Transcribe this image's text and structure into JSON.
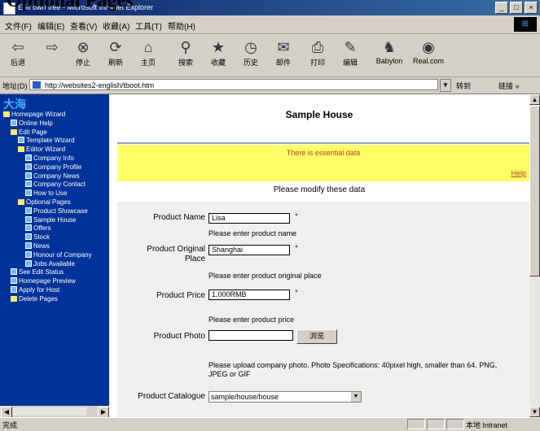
{
  "slide_title": "Optional Pages",
  "window": {
    "title": "Edit own tree - Microsoft Internet Explorer",
    "controls": [
      "_",
      "□",
      "×"
    ]
  },
  "menu": {
    "items": [
      "文件(F)",
      "编辑(E)",
      "查看(V)",
      "收藏(A)",
      "工具(T)",
      "帮助(H)"
    ]
  },
  "toolbar": {
    "buttons": [
      {
        "label": "后退",
        "icon": "back-arrow-icon",
        "glyph": "⇦"
      },
      {
        "label": "",
        "icon": "forward-arrow-icon",
        "glyph": "⇨"
      },
      {
        "label": "停止",
        "icon": "stop-icon",
        "glyph": "⊗"
      },
      {
        "label": "刷新",
        "icon": "refresh-icon",
        "glyph": "⟳"
      },
      {
        "label": "主页",
        "icon": "home-icon",
        "glyph": "⌂"
      },
      {
        "label": "搜索",
        "icon": "search-icon",
        "glyph": "⚲"
      },
      {
        "label": "收藏",
        "icon": "favorites-icon",
        "glyph": "★"
      },
      {
        "label": "历史",
        "icon": "history-icon",
        "glyph": "◷"
      },
      {
        "label": "邮件",
        "icon": "mail-icon",
        "glyph": "✉"
      },
      {
        "label": "打印",
        "icon": "print-icon",
        "glyph": "⎙"
      },
      {
        "label": "编辑",
        "icon": "edit-icon",
        "glyph": "✎"
      },
      {
        "label": "Babylon",
        "icon": "babylon-icon",
        "glyph": "♞"
      },
      {
        "label": "Real.com",
        "icon": "real-icon",
        "glyph": "◉"
      }
    ]
  },
  "address": {
    "label": "地址(D)",
    "url": "http://websites2-english/tboot.htm",
    "go": "转到",
    "links": "链接 »"
  },
  "sidebar": {
    "header": "大海",
    "tree": [
      {
        "label": "Homepage Wizard",
        "icon": "book",
        "indent": 0
      },
      {
        "label": "Online Help",
        "icon": "page",
        "indent": 1
      },
      {
        "label": "Edit Page",
        "icon": "book",
        "indent": 1
      },
      {
        "label": "Template Wizard",
        "icon": "page",
        "indent": 2
      },
      {
        "label": "Editor Wizard",
        "icon": "book",
        "indent": 2
      },
      {
        "label": "Company Info",
        "icon": "page",
        "indent": 3
      },
      {
        "label": "Company Profile",
        "icon": "page",
        "indent": 3
      },
      {
        "label": "Company News",
        "icon": "page",
        "indent": 3
      },
      {
        "label": "Company Contact",
        "icon": "page",
        "indent": 3
      },
      {
        "label": "How to Use",
        "icon": "page",
        "indent": 3
      },
      {
        "label": "Optional Pages",
        "icon": "book",
        "indent": 2
      },
      {
        "label": "Product Showcase",
        "icon": "page",
        "indent": 3
      },
      {
        "label": "Sample House",
        "icon": "page",
        "indent": 3
      },
      {
        "label": "Offers",
        "icon": "page",
        "indent": 3
      },
      {
        "label": "Stock",
        "icon": "page",
        "indent": 3
      },
      {
        "label": "News",
        "icon": "page",
        "indent": 3
      },
      {
        "label": "Honour of Company",
        "icon": "page",
        "indent": 3
      },
      {
        "label": "Jobs Available",
        "icon": "page",
        "indent": 3
      },
      {
        "label": "See Edit Status",
        "icon": "page",
        "indent": 1
      },
      {
        "label": "Homepage Preview",
        "icon": "page",
        "indent": 1
      },
      {
        "label": "Apply for Host",
        "icon": "page",
        "indent": 1
      },
      {
        "label": "Delete Pages",
        "icon": "book",
        "indent": 1
      }
    ]
  },
  "page": {
    "heading": "Sample House",
    "banner_message": "There is essential data",
    "help_link": "Help",
    "modify_text": "Please modify these data",
    "required_mark": "*",
    "fields": {
      "product_name": {
        "label": "Product Name",
        "value": "Lisa",
        "hint": "Please enter product name"
      },
      "original_place": {
        "label_line1": "Product Original",
        "label_line2": "Place",
        "value": "Shanghai",
        "hint": "Please enter product original place"
      },
      "product_price": {
        "label": "Product Price",
        "value": "1,000RMB",
        "hint": "Please enter product price"
      },
      "product_photo": {
        "label": "Product Photo",
        "value": "",
        "browse": "浏览",
        "hint": "Please upload company photo. Photo Specifications: 40pixel high, smaller than 64. PNG, JPEG or GIF"
      },
      "catalog": {
        "label": "Product Catalogue",
        "value": "sample/house/house"
      }
    }
  },
  "status": {
    "left": "完成",
    "zone": "本地 Intranet"
  },
  "colors": {
    "sidebar_bg": "#003399",
    "banner_bg": "#ffff66",
    "form_bg": "#efefef",
    "title_bar": "#0a246a"
  }
}
